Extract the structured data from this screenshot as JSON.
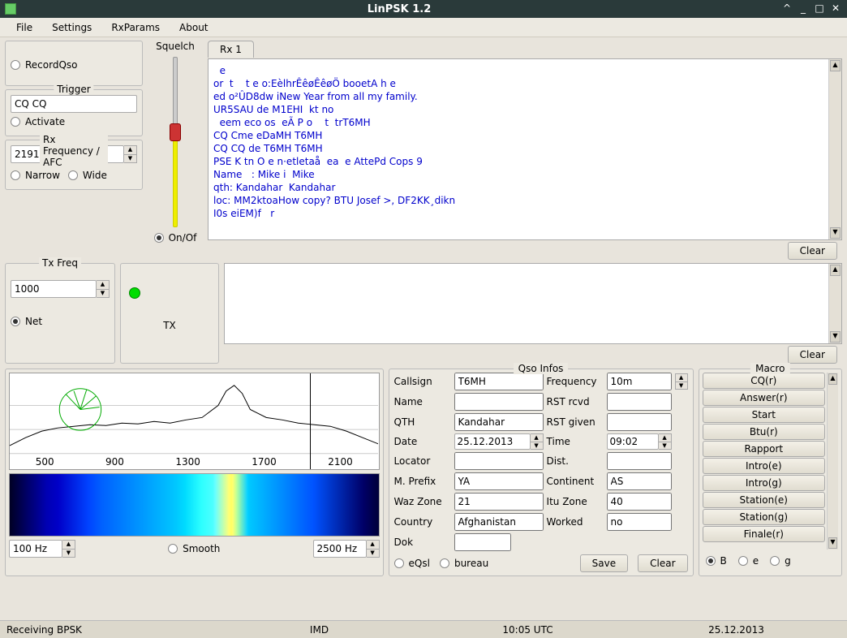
{
  "window": {
    "title": "LinPSK 1.2"
  },
  "menu": {
    "file": "File",
    "settings": "Settings",
    "rxparams": "RxParams",
    "about": "About"
  },
  "recordqso": {
    "label": "RecordQso"
  },
  "trigger": {
    "title": "Trigger",
    "value": "CQ CQ",
    "activate": "Activate"
  },
  "rxfreq": {
    "title": "Rx Frequency / AFC",
    "value": "2191",
    "narrow": "Narrow",
    "wide": "Wide"
  },
  "squelch": {
    "label": "Squelch",
    "onoff": "On/Of"
  },
  "rx": {
    "tab": "Rx 1",
    "text": "  e\nor  t    t e o:EèlhrÊêøÊêøÖ booetA h e\ned o²ÛD8dw iNew Year from all my family.\nUR5SAU de M1EHI  kt no\n  eem eco os  eÃ P o    t  trT6MH\nCQ Cme eDaMH T6MH\nCQ CQ de T6MH T6MH\nPSE K tn O e n·etletaå  ea  e AttePd Cops 9\nName   : Mike i  Mike\nqth: Kandahar  Kandahar\nloc: MM2ktoaHow copy? BTU Josef >, DF2KK¸dikn\nI0s eiEM)f   r",
    "clear": "Clear"
  },
  "txfreq": {
    "title": "Tx Freq",
    "value": "1000",
    "net": "Net",
    "tx": "TX"
  },
  "txedit": {
    "clear": "Clear"
  },
  "spectrum": {
    "ticks": [
      "500",
      "900",
      "1300",
      "1700",
      "2100"
    ],
    "low": "100 Hz",
    "smooth": "Smooth",
    "high": "2500 Hz"
  },
  "qso": {
    "title": "Qso Infos",
    "labels": {
      "callsign": "Callsign",
      "frequency": "Frequency",
      "name": "Name",
      "rstrcvd": "RST rcvd",
      "qth": "QTH",
      "rstgiven": "RST given",
      "date": "Date",
      "time": "Time",
      "locator": "Locator",
      "dist": "Dist.",
      "mprefix": "M. Prefix",
      "continent": "Continent",
      "wazzone": "Waz Zone",
      "ituzone": "Itu Zone",
      "country": "Country",
      "worked": "Worked",
      "dok": "Dok"
    },
    "values": {
      "callsign": "T6MH",
      "frequency": "10m",
      "name": "",
      "rstrcvd": "",
      "qth": "Kandahar",
      "rstgiven": "",
      "date": "25.12.2013",
      "time": "09:02",
      "locator": "",
      "dist": "",
      "mprefix": "YA",
      "continent": "AS",
      "wazzone": "21",
      "ituzone": "40",
      "country": "Afghanistan",
      "worked": "no",
      "dok": ""
    },
    "eqsl": "eQsl",
    "bureau": "bureau",
    "save": "Save",
    "clear": "Clear"
  },
  "macro": {
    "title": "Macro",
    "items": [
      "CQ(r)",
      "Answer(r)",
      "Start",
      "Btu(r)",
      "Rapport",
      "Intro(e)",
      "Intro(g)",
      "Station(e)",
      "Station(g)",
      "Finale(r)"
    ],
    "radios": [
      "B",
      "e",
      "g"
    ]
  },
  "status": {
    "mode": "Receiving BPSK",
    "imd": "IMD",
    "utc": "10:05 UTC",
    "date": "25.12.2013"
  }
}
